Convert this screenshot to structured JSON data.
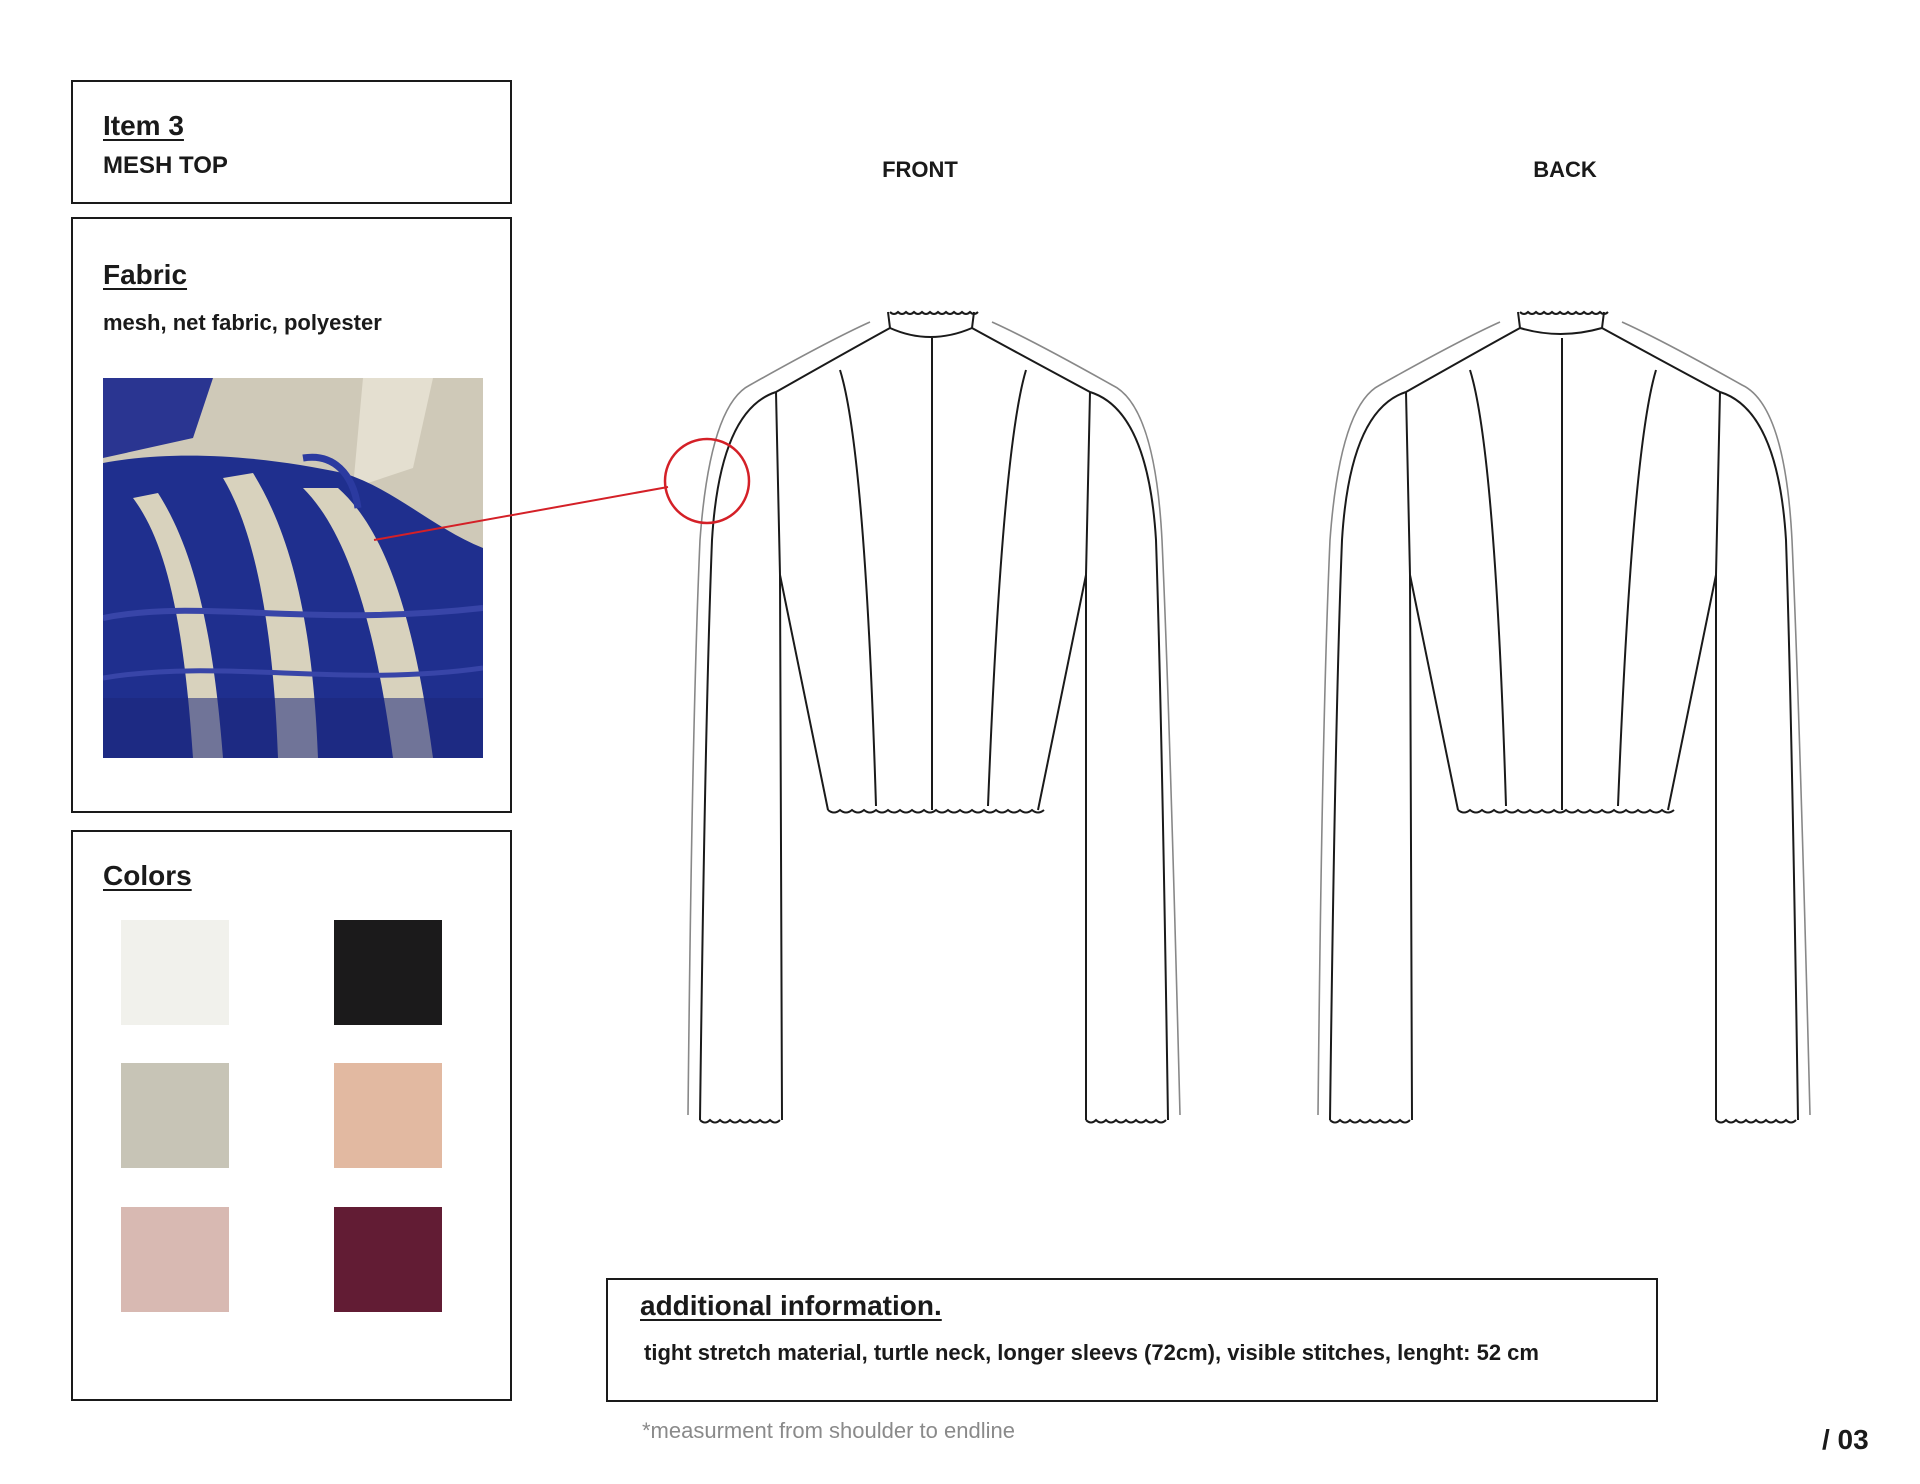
{
  "item": {
    "title": "Item 3",
    "name": "MESH TOP"
  },
  "fabric": {
    "heading": "Fabric",
    "description": "mesh, net fabric, polyester",
    "photo_colors": {
      "stripe_blue": "#1f2f8e",
      "stripe_light": "#d8d2bd",
      "background": "#cfc9b8"
    }
  },
  "colors": {
    "heading": "Colors",
    "swatches": [
      {
        "hex": "#f1f1ec"
      },
      {
        "hex": "#1b1a1b"
      },
      {
        "hex": "#c7c4b6"
      },
      {
        "hex": "#e2b9a1"
      },
      {
        "hex": "#d8b9b2"
      },
      {
        "hex": "#621c34"
      }
    ]
  },
  "views": {
    "front_label": "FRONT",
    "back_label": "BACK"
  },
  "additional_info": {
    "heading": "additional information.",
    "text": "tight stretch material, turtle neck, longer sleevs (72cm), visible stitches, lenght: 52 cm"
  },
  "footnote": "*measurment from shoulder to endline",
  "page_number": "/ 03",
  "callout_color": "#d42027"
}
